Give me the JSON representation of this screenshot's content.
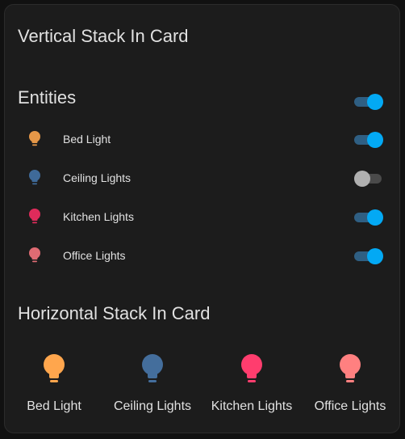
{
  "card": {
    "title": "Vertical Stack In Card"
  },
  "entities": {
    "title": "Entities",
    "master_toggle_on": true,
    "rows": [
      {
        "label": "Bed Light",
        "icon": "lightbulb-icon",
        "icon_color": "#e59748",
        "on": true
      },
      {
        "label": "Ceiling Lights",
        "icon": "lightbulb-icon",
        "icon_color": "#3f6a99",
        "on": false
      },
      {
        "label": "Kitchen Lights",
        "icon": "lightbulb-icon",
        "icon_color": "#df2b5b",
        "on": true
      },
      {
        "label": "Office Lights",
        "icon": "lightbulb-icon",
        "icon_color": "#df6b73",
        "on": true
      }
    ]
  },
  "horizontal": {
    "title": "Horizontal Stack In Card",
    "tiles": [
      {
        "label": "Bed Light",
        "icon": "lightbulb-icon",
        "icon_color": "#ffa64d"
      },
      {
        "label": "Ceiling Lights",
        "icon": "lightbulb-icon",
        "icon_color": "#446e9c"
      },
      {
        "label": "Kitchen Lights",
        "icon": "lightbulb-icon",
        "icon_color": "#ff3d6e"
      },
      {
        "label": "Office Lights",
        "icon": "lightbulb-icon",
        "icon_color": "#ff8080"
      }
    ]
  },
  "colors": {
    "background": "#111111",
    "card": "#1c1c1c",
    "text": "#e1e1e1",
    "toggle_on": "#03a9f4",
    "toggle_off": "#b0b0b0"
  }
}
